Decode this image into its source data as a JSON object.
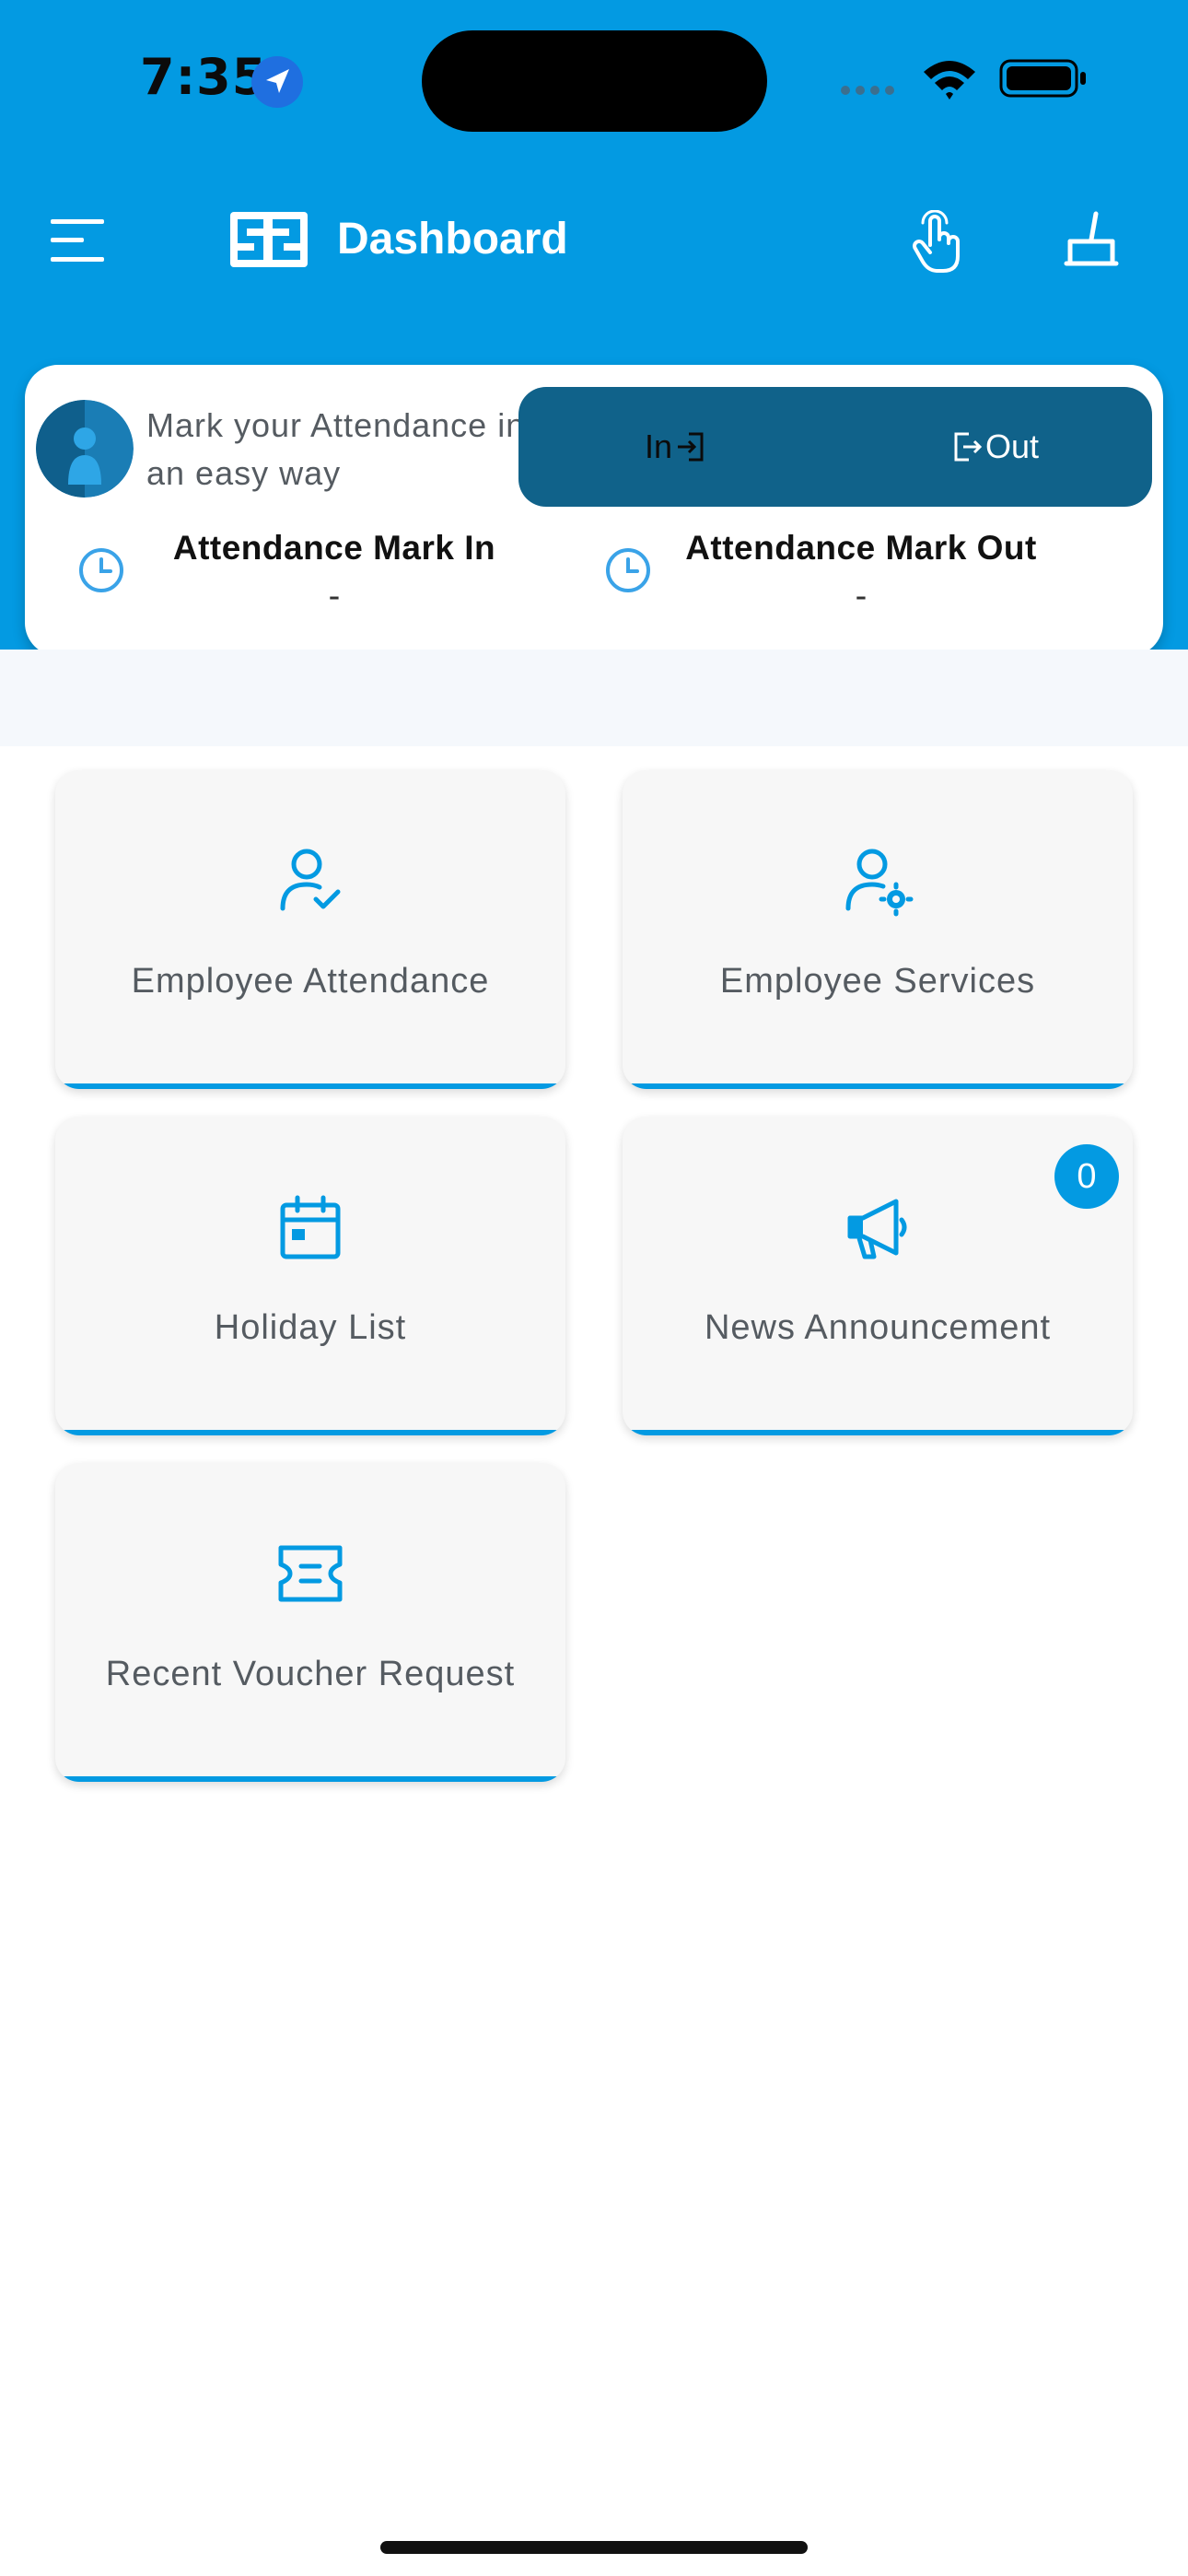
{
  "status_bar": {
    "time": "7:35"
  },
  "app_bar": {
    "title": "Dashboard"
  },
  "attendance_card": {
    "promo_text": "Mark your Attendance in an easy way",
    "in_label": "In",
    "out_label": "Out",
    "mark_in_title": "Attendance Mark In",
    "mark_in_value": "-",
    "mark_out_title": "Attendance Mark Out",
    "mark_out_value": "-"
  },
  "tiles": [
    {
      "label": "Employee Attendance",
      "icon": "user-check-icon"
    },
    {
      "label": "Employee Services",
      "icon": "user-gear-icon"
    },
    {
      "label": "Holiday List",
      "icon": "calendar-icon"
    },
    {
      "label": "News Announcement",
      "icon": "megaphone-icon",
      "badge": "0"
    },
    {
      "label": "Recent Voucher Request",
      "icon": "ticket-icon"
    }
  ],
  "colors": {
    "primary": "#039ae2",
    "dark_button": "#10628a",
    "tile_background": "#f7f7f7"
  }
}
